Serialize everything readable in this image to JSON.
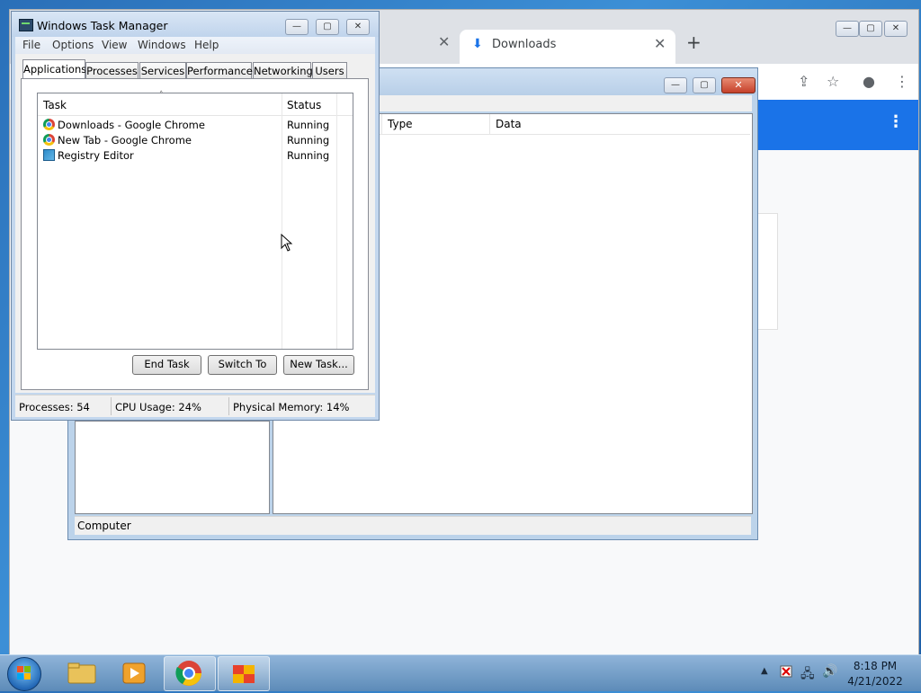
{
  "chrome": {
    "tab_title": "Downloads",
    "tab_close": "✕",
    "prev_tab_close": "✕",
    "new_tab": "+",
    "win_min": "—",
    "win_max": "▢",
    "win_close": "✕",
    "share_icon": "⇪",
    "star_icon": "☆",
    "profile_icon": "●",
    "menu_icon": "⋮",
    "banner_menu": "⋮"
  },
  "regedit": {
    "columns": [
      "Type",
      "Data"
    ],
    "status": "Computer",
    "btn_min": "—",
    "btn_max": "▢",
    "btn_close": "✕"
  },
  "taskmgr": {
    "title": "Windows Task Manager",
    "btn_min": "—",
    "btn_max": "▢",
    "btn_close": "✕",
    "menu": [
      "File",
      "Options",
      "View",
      "Windows",
      "Help"
    ],
    "tabs": [
      "Applications",
      "Processes",
      "Services",
      "Performance",
      "Networking",
      "Users"
    ],
    "active_tab": "Applications",
    "columns": {
      "task": "Task",
      "status": "Status"
    },
    "rows": [
      {
        "name": "Downloads - Google Chrome",
        "status": "Running",
        "icon": "chrome-icon"
      },
      {
        "name": "New Tab - Google Chrome",
        "status": "Running",
        "icon": "chrome-icon"
      },
      {
        "name": "Registry Editor",
        "status": "Running",
        "icon": "registry-editor-icon"
      }
    ],
    "buttons": {
      "end_task": "End Task",
      "switch_to": "Switch To",
      "new_task": "New Task..."
    },
    "statusbar": {
      "processes": "Processes: 54",
      "cpu": "CPU Usage: 24%",
      "memory": "Physical Memory: 14%"
    }
  },
  "taskbar": {
    "time": "8:18 PM",
    "date": "4/21/2022",
    "tray_arrow": "▲",
    "volume_icon": "🔊",
    "network_icon": "🖧"
  }
}
